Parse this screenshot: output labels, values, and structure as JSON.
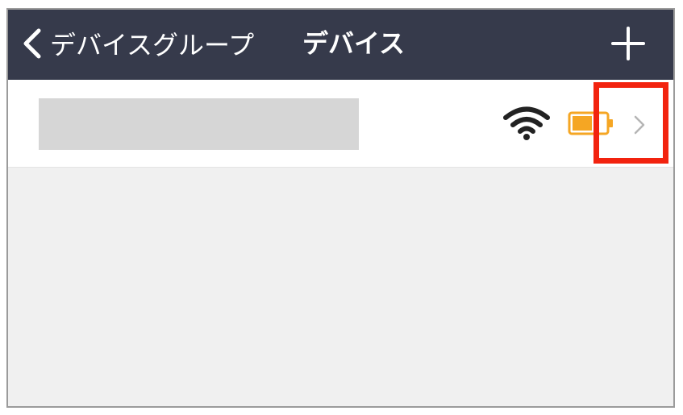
{
  "navbar": {
    "back_label": "デバイスグループ",
    "title": "デバイス",
    "add_icon": "plus-icon",
    "back_icon": "chevron-left-icon"
  },
  "device_list": {
    "items": [
      {
        "name": "",
        "wifi_icon": "wifi-icon",
        "battery_icon": "battery-icon",
        "battery_level": 0.6,
        "disclosure_icon": "chevron-right-icon"
      }
    ]
  },
  "colors": {
    "navbar_bg": "#363a4b",
    "battery": "#f5a623",
    "highlight": "#f2230f",
    "background": "#f0f0f0"
  }
}
